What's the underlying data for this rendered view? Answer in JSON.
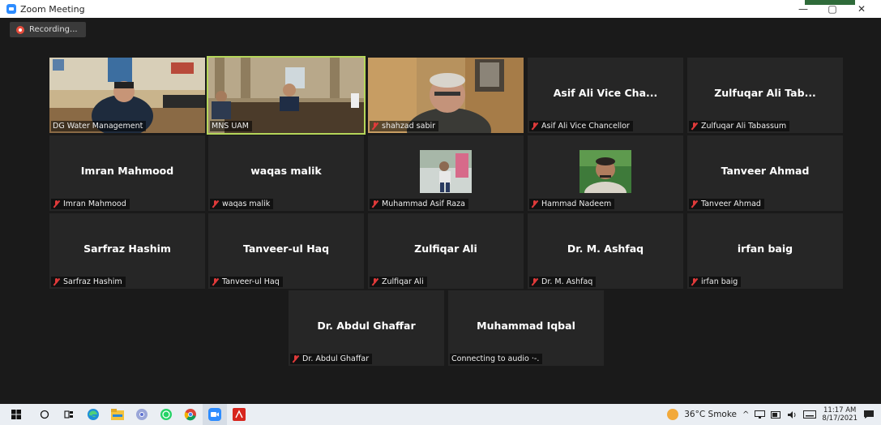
{
  "window": {
    "title": "Zoom Meeting",
    "minimize": "—",
    "maximize": "▢",
    "close": "✕"
  },
  "recording": {
    "label": "Recording..."
  },
  "participants": [
    {
      "name": "DG Water Management",
      "display": "",
      "muted": false
    },
    {
      "name": "MNS UAM",
      "display": "",
      "muted": false
    },
    {
      "name": "shahzad sabir",
      "display": "",
      "muted": true
    },
    {
      "name": "Asif Ali Vice Chancellor",
      "display": "Asif Ali Vice Cha...",
      "muted": true
    },
    {
      "name": "Zulfuqar Ali Tabassum",
      "display": "Zulfuqar Ali Tab...",
      "muted": true
    },
    {
      "name": "Imran Mahmood",
      "display": "Imran Mahmood",
      "muted": true
    },
    {
      "name": "waqas malik",
      "display": "waqas malik",
      "muted": true
    },
    {
      "name": "Muhammad Asif Raza",
      "display": "",
      "muted": true
    },
    {
      "name": "Hammad Nadeem",
      "display": "",
      "muted": true
    },
    {
      "name": "Tanveer Ahmad",
      "display": "Tanveer Ahmad",
      "muted": true
    },
    {
      "name": "Sarfraz Hashim",
      "display": "Sarfraz Hashim",
      "muted": true
    },
    {
      "name": "Tanveer-ul Haq",
      "display": "Tanveer-ul Haq",
      "muted": true
    },
    {
      "name": "Zulfiqar Ali",
      "display": "Zulfiqar Ali",
      "muted": true
    },
    {
      "name": "Dr. M. Ashfaq",
      "display": "Dr. M. Ashfaq",
      "muted": true
    },
    {
      "name": "irfan baig",
      "display": "irfan baig",
      "muted": true
    },
    {
      "name": "Dr. Abdul Ghaffar",
      "display": "Dr. Abdul Ghaffar",
      "muted": true
    },
    {
      "name": "Connecting to audio ·-.",
      "display": "Muhammad Iqbal",
      "muted": false
    }
  ],
  "taskbar": {
    "weather": "36°C  Smoke",
    "time": "11:17 AM",
    "date": "8/17/2021",
    "icons": [
      "windows-start-icon",
      "search-icon",
      "task-view-icon",
      "edge-icon",
      "file-explorer-icon",
      "chrome-canary-icon",
      "whatsapp-icon",
      "chrome-icon",
      "zoom-icon",
      "acrobat-icon"
    ]
  }
}
